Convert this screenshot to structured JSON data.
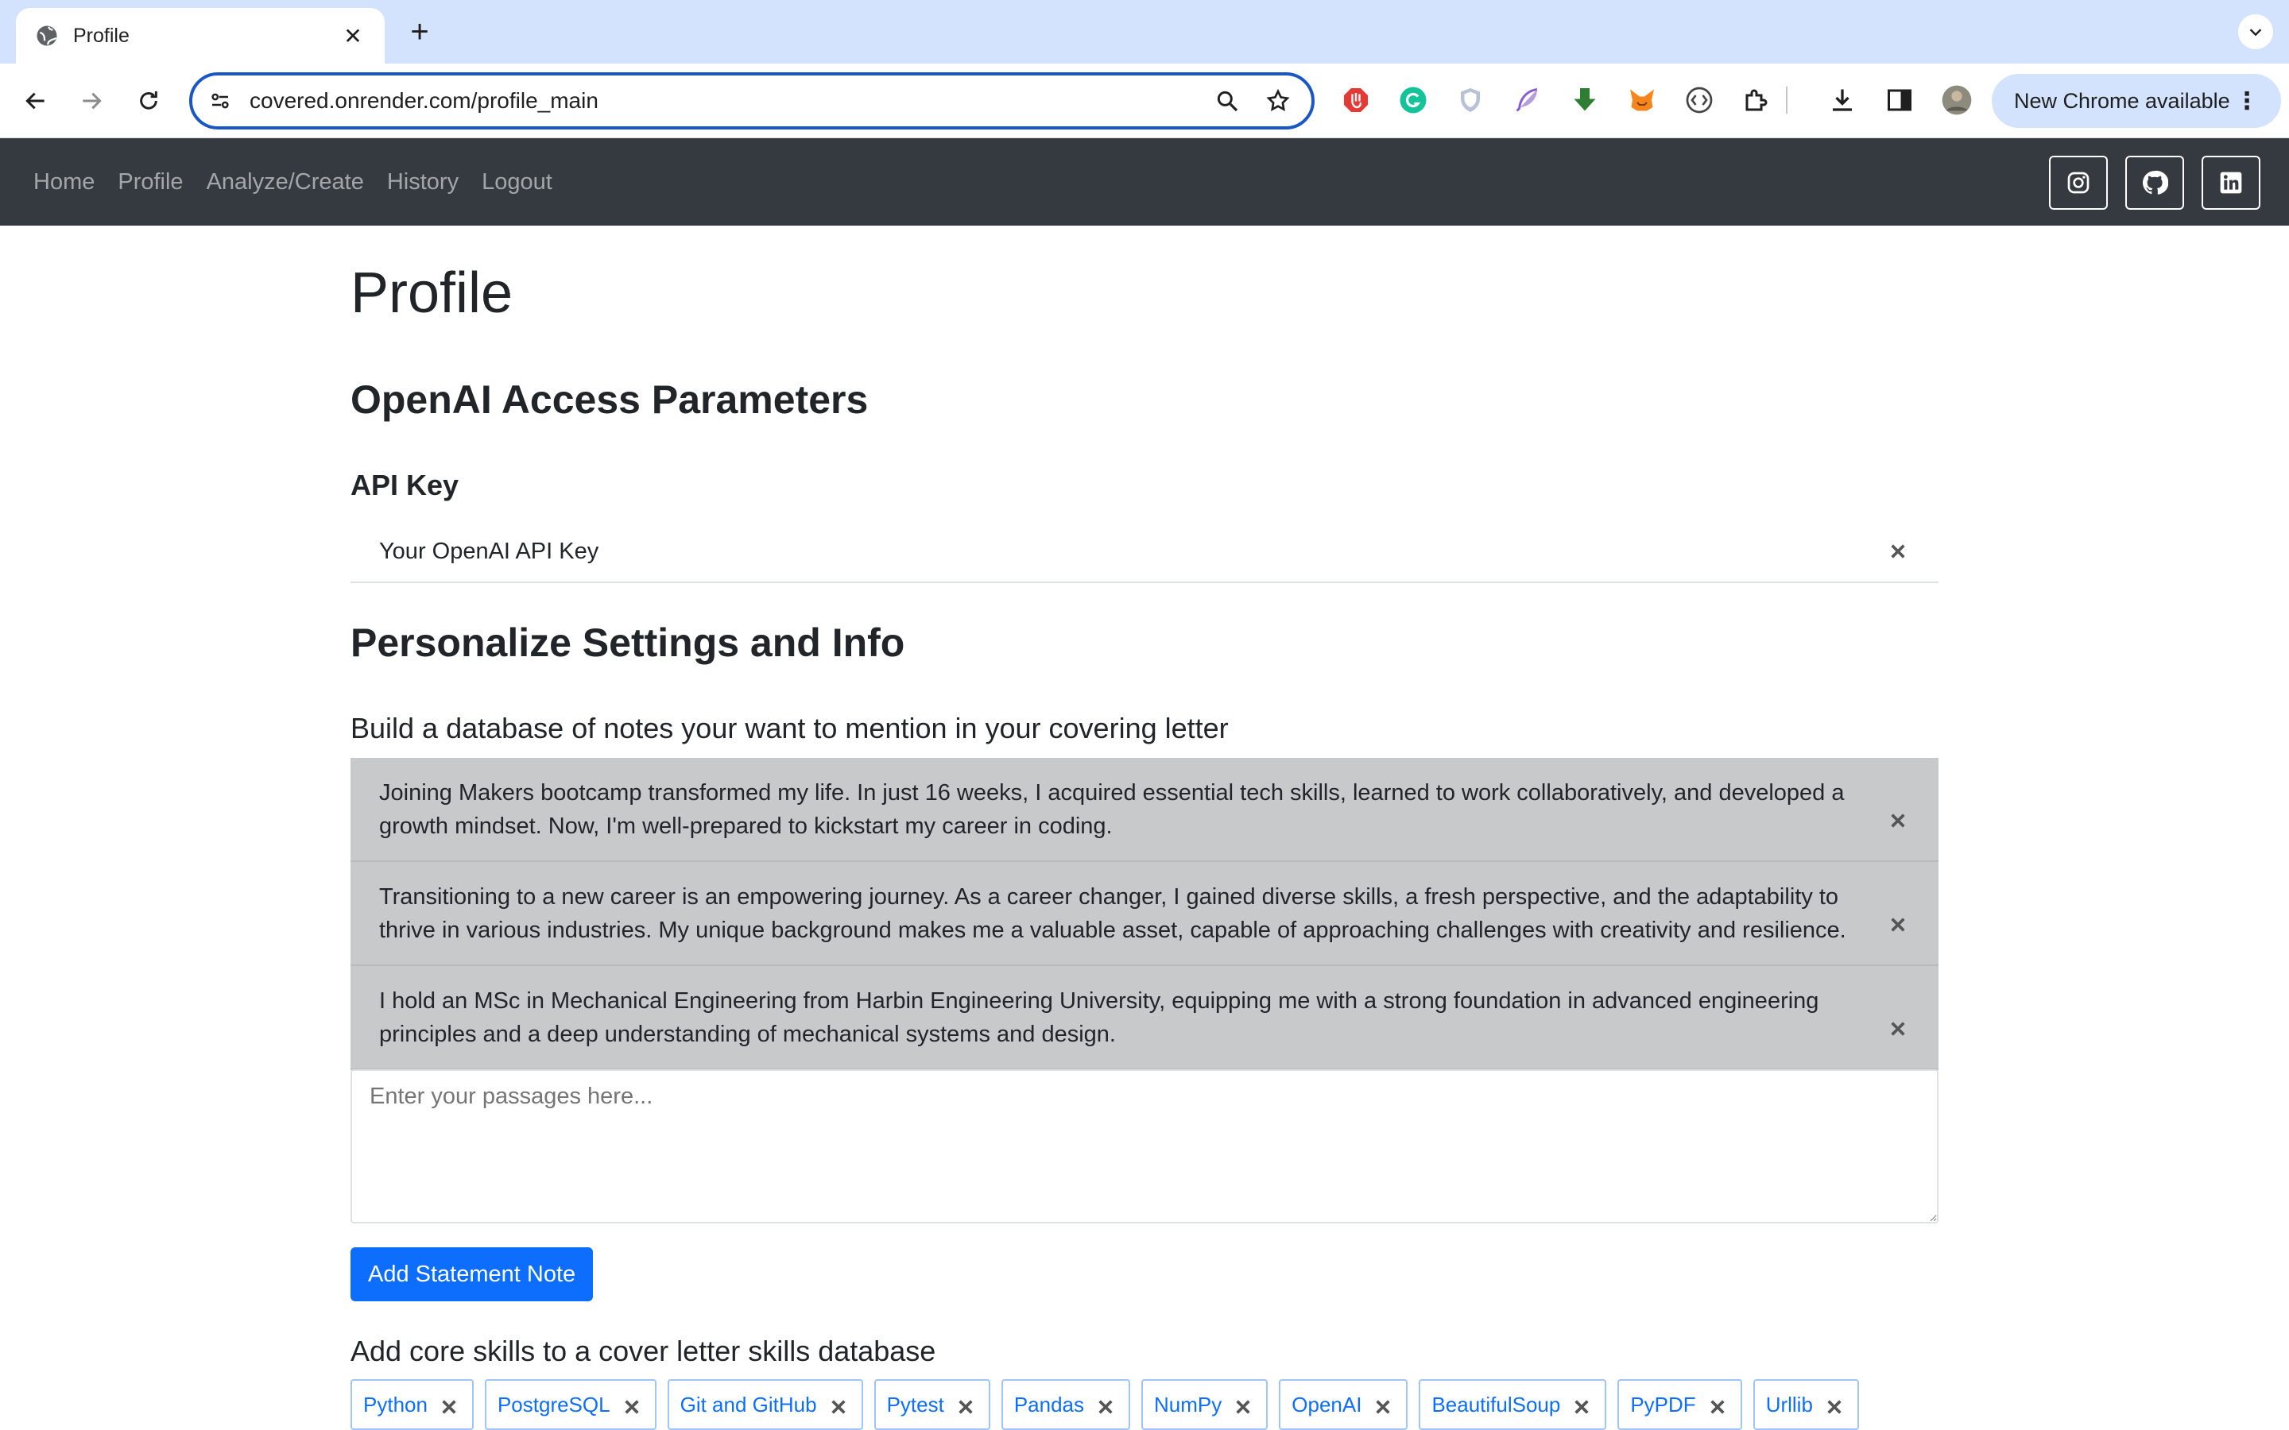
{
  "browser": {
    "tab_title": "Profile",
    "url": "covered.onrender.com/profile_main",
    "new_chrome_label": "New Chrome available"
  },
  "navbar": {
    "links": [
      "Home",
      "Profile",
      "Analyze/Create",
      "History",
      "Logout"
    ],
    "social_icons": [
      "instagram-icon",
      "github-icon",
      "linkedin-icon"
    ]
  },
  "page": {
    "title": "Profile",
    "openai_heading": "OpenAI Access Parameters",
    "api_key_label": "API Key",
    "api_key_value": "Your OpenAI API Key",
    "personalize_heading": "Personalize Settings and Info",
    "notes_heading": "Build a database of notes your want to mention in your covering letter",
    "notes": [
      "Joining Makers bootcamp transformed my life. In just 16 weeks, I acquired essential tech skills, learned to work collaboratively, and developed a growth mindset. Now, I'm well-prepared to kickstart my career in coding.",
      "Transitioning to a new career is an empowering journey. As a career changer, I gained diverse skills, a fresh perspective, and the adaptability to thrive in various industries. My unique background makes me a valuable asset, capable of approaching challenges with creativity and resilience.",
      "I hold an MSc in Mechanical Engineering from Harbin Engineering University, equipping me with a strong foundation in advanced engineering principles and a deep understanding of mechanical systems and design."
    ],
    "passage_placeholder": "Enter your passages here...",
    "add_note_button": "Add Statement Note",
    "skills_heading": "Add core skills to a cover letter skills database",
    "skills": [
      "Python",
      "PostgreSQL",
      "Git and GitHub",
      "Pytest",
      "Pandas",
      "NumPy",
      "OpenAI",
      "BeautifulSoup",
      "PyPDF",
      "Urllib"
    ]
  },
  "colors": {
    "navbar_bg": "#343a40",
    "primary": "#0d6efd",
    "note_bg": "#c8c9cb",
    "tabstrip_bg": "#d3e3fd"
  }
}
